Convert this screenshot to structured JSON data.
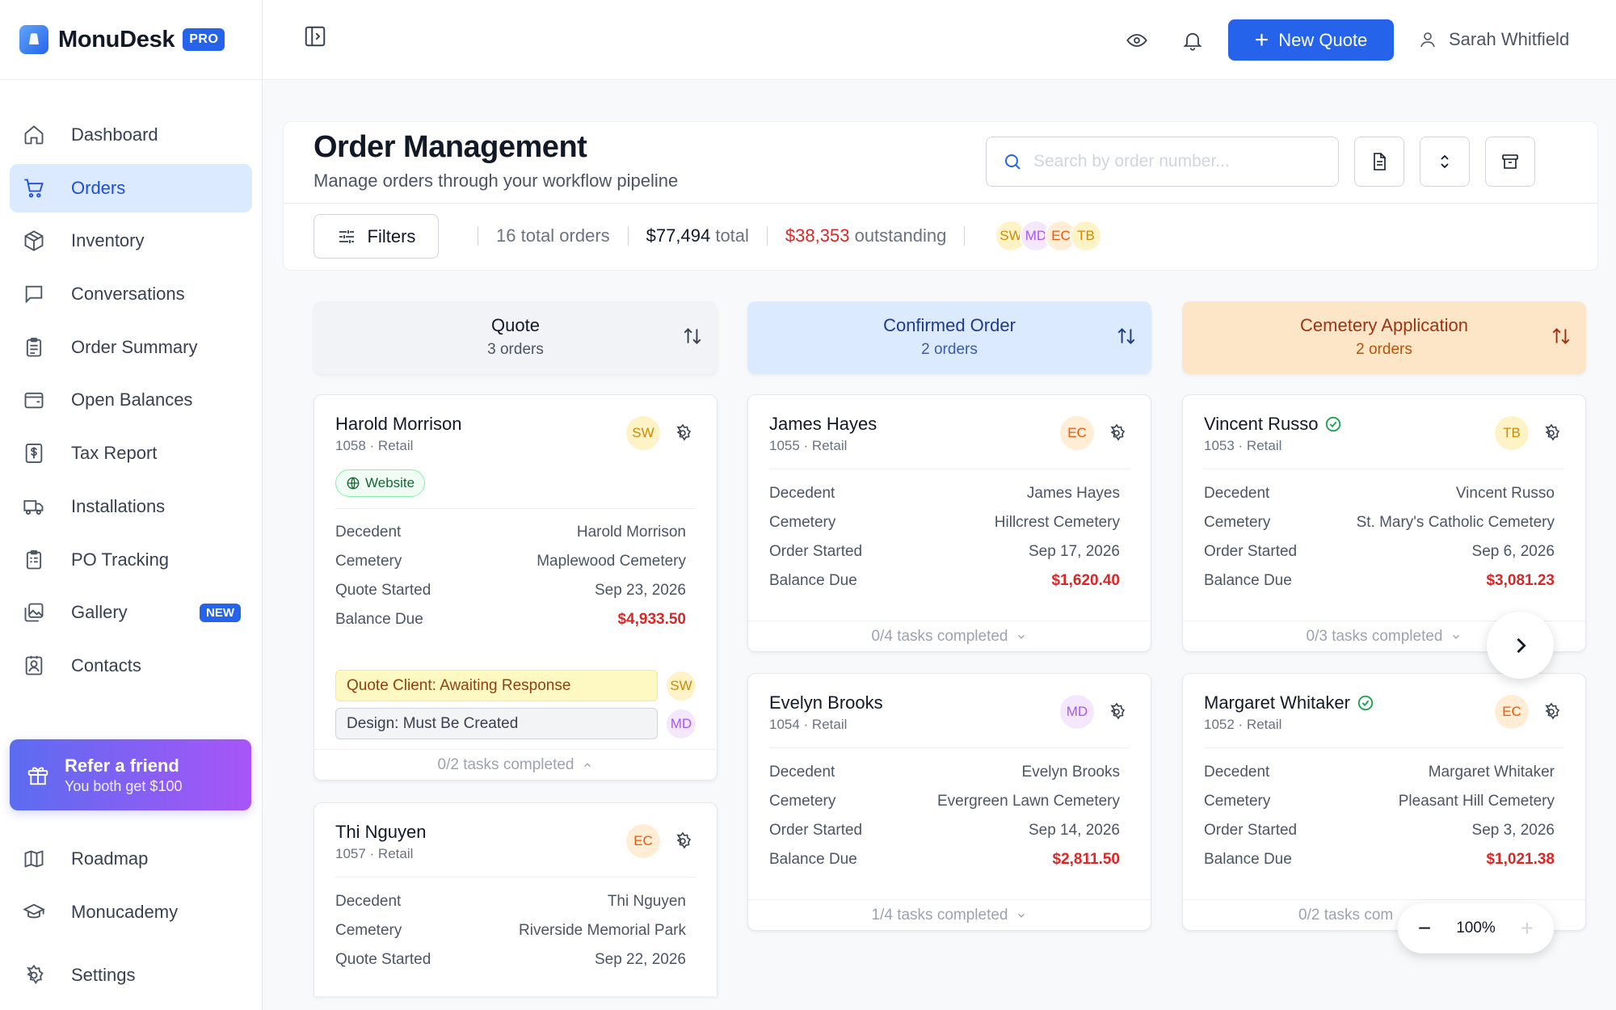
{
  "brand": {
    "name": "MonuDesk",
    "badge": "PRO"
  },
  "sidebar": {
    "items": [
      {
        "label": "Dashboard",
        "icon": "home-icon"
      },
      {
        "label": "Orders",
        "icon": "cart-icon",
        "active": true
      },
      {
        "label": "Inventory",
        "icon": "box-icon"
      },
      {
        "label": "Conversations",
        "icon": "chat-icon"
      },
      {
        "label": "Order Summary",
        "icon": "clipboard-icon"
      },
      {
        "label": "Open Balances",
        "icon": "wallet-icon"
      },
      {
        "label": "Tax Report",
        "icon": "dollar-doc-icon"
      },
      {
        "label": "Installations",
        "icon": "truck-icon"
      },
      {
        "label": "PO Tracking",
        "icon": "clipboard-list-icon"
      },
      {
        "label": "Gallery",
        "icon": "image-icon",
        "badge": "NEW"
      },
      {
        "label": "Contacts",
        "icon": "contact-icon"
      }
    ],
    "refer": {
      "title": "Refer a friend",
      "subtitle": "You both get $100"
    },
    "bottom_items": [
      {
        "label": "Roadmap",
        "icon": "map-icon"
      },
      {
        "label": "Monucademy",
        "icon": "graduation-cap-icon"
      },
      {
        "label": "Settings",
        "icon": "gear-icon"
      }
    ]
  },
  "topbar": {
    "new_quote_label": "New Quote",
    "user_name": "Sarah Whitfield"
  },
  "header": {
    "title": "Order Management",
    "subtitle": "Manage orders through your workflow pipeline",
    "search_placeholder": "Search by order number...",
    "filters_label": "Filters",
    "stats": {
      "total_orders_num": "16",
      "total_orders_label": "total orders",
      "total_amount": "$77,494",
      "total_label": "total",
      "outstanding_amount": "$38,353",
      "outstanding_label": "outstanding"
    },
    "avatars": [
      "SW",
      "MD",
      "EC",
      "TB"
    ]
  },
  "columns": [
    {
      "title": "Quote",
      "count": "3 orders"
    },
    {
      "title": "Confirmed Order",
      "count": "2 orders"
    },
    {
      "title": "Cemetery Application",
      "count": "2 orders"
    }
  ],
  "cards": {
    "harold": {
      "name": "Harold Morrison",
      "meta": "1058 · Retail",
      "avatar": "SW",
      "source": "Website",
      "rows": [
        [
          "Decedent",
          "Harold Morrison"
        ],
        [
          "Cemetery",
          "Maplewood Cemetery"
        ],
        [
          "Quote Started",
          "Sep 23, 2026"
        ],
        [
          "Balance Due",
          "$4,933.50"
        ]
      ],
      "tags": [
        {
          "label": "Quote Client: Awaiting Response",
          "avatar": "SW"
        },
        {
          "label": "Design: Must Be Created",
          "avatar": "MD"
        }
      ],
      "tasks": "0/2 tasks completed"
    },
    "thi": {
      "name": "Thi Nguyen",
      "meta": "1057 · Retail",
      "avatar": "EC",
      "rows": [
        [
          "Decedent",
          "Thi Nguyen"
        ],
        [
          "Cemetery",
          "Riverside Memorial Park"
        ],
        [
          "Quote Started",
          "Sep 22, 2026"
        ]
      ]
    },
    "james": {
      "name": "James Hayes",
      "meta": "1055 · Retail",
      "avatar": "EC",
      "rows": [
        [
          "Decedent",
          "James Hayes"
        ],
        [
          "Cemetery",
          "Hillcrest Cemetery"
        ],
        [
          "Order Started",
          "Sep 17, 2026"
        ],
        [
          "Balance Due",
          "$1,620.40"
        ]
      ],
      "tasks": "0/4 tasks completed"
    },
    "evelyn": {
      "name": "Evelyn Brooks",
      "meta": "1054 · Retail",
      "avatar": "MD",
      "rows": [
        [
          "Decedent",
          "Evelyn Brooks"
        ],
        [
          "Cemetery",
          "Evergreen Lawn Cemetery"
        ],
        [
          "Order Started",
          "Sep 14, 2026"
        ],
        [
          "Balance Due",
          "$2,811.50"
        ]
      ],
      "tasks": "1/4 tasks completed"
    },
    "vincent": {
      "name": "Vincent Russo",
      "meta": "1053 · Retail",
      "avatar": "TB",
      "rows": [
        [
          "Decedent",
          "Vincent Russo"
        ],
        [
          "Cemetery",
          "St. Mary's Catholic Cemetery"
        ],
        [
          "Order Started",
          "Sep 6, 2026"
        ],
        [
          "Balance Due",
          "$3,081.23"
        ]
      ],
      "tasks": "0/3 tasks completed"
    },
    "margaret": {
      "name": "Margaret Whitaker",
      "meta": "1052 · Retail",
      "avatar": "EC",
      "rows": [
        [
          "Decedent",
          "Margaret Whitaker"
        ],
        [
          "Cemetery",
          "Pleasant Hill Cemetery"
        ],
        [
          "Order Started",
          "Sep 3, 2026"
        ],
        [
          "Balance Due",
          "$1,021.38"
        ]
      ],
      "tasks": "0/2 tasks com"
    }
  },
  "zoom": {
    "value": "100%",
    "minus": "−",
    "plus": "+"
  },
  "colors": {
    "accent": "#2563eb",
    "danger": "#dc2626",
    "refer_from": "#5b6cf0",
    "refer_to": "#a855f7"
  }
}
